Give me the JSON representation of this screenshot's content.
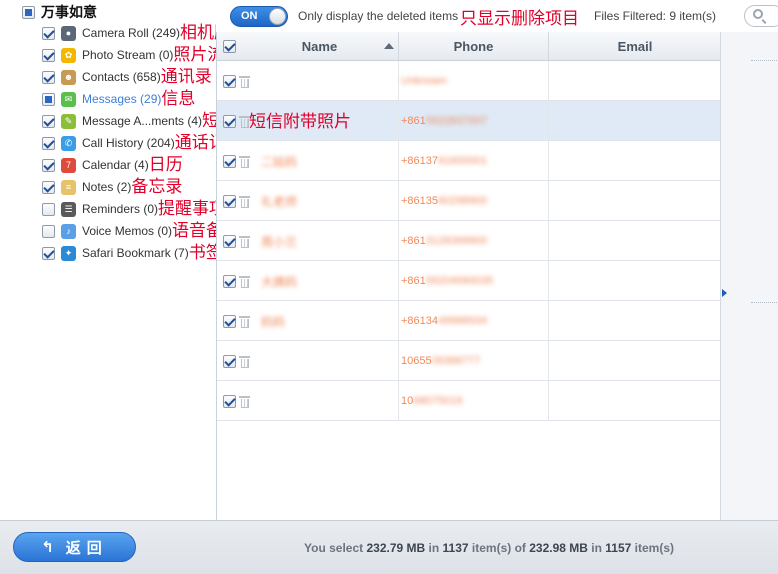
{
  "sidebar": {
    "root": {
      "title": "万事如意",
      "state": "partial"
    },
    "items": [
      {
        "key": "camera-roll",
        "label": "Camera Roll (249)",
        "note": "相机胶卷",
        "state": "checked",
        "icon_color": "#5a6878",
        "glyph": "●"
      },
      {
        "key": "photo-stream",
        "label": "Photo Stream (0)",
        "note": "照片流媒体",
        "state": "checked",
        "icon_color": "#f2b800",
        "glyph": "✿"
      },
      {
        "key": "contacts",
        "label": "Contacts (658)",
        "note": "通讯录",
        "state": "checked",
        "icon_color": "#c89a52",
        "glyph": "☻"
      },
      {
        "key": "messages",
        "label": "Messages (29)",
        "note": "信息",
        "state": "partial",
        "icon_color": "#5bbf4c",
        "glyph": "✉"
      },
      {
        "key": "message-attachments",
        "label": "Message A...ments (4)",
        "note": "短信附带照片",
        "state": "checked",
        "icon_color": "#8bbf3a",
        "glyph": "✎"
      },
      {
        "key": "call-history",
        "label": "Call History (204)",
        "note": "通话记录",
        "state": "checked",
        "icon_color": "#3a9ee6",
        "glyph": "✆"
      },
      {
        "key": "calendar",
        "label": "Calendar (4)",
        "note": "日历",
        "state": "checked",
        "icon_color": "#e04a3a",
        "glyph": "7"
      },
      {
        "key": "notes",
        "label": "Notes (2)",
        "note": "备忘录",
        "state": "checked",
        "icon_color": "#e6c26a",
        "glyph": "≡"
      },
      {
        "key": "reminders",
        "label": "Reminders (0)",
        "note": "提醒事项",
        "state": "unchecked",
        "icon_color": "#5a5a5a",
        "glyph": "☰"
      },
      {
        "key": "voice-memos",
        "label": "Voice Memos (0)",
        "note": "语音备忘录",
        "state": "unchecked",
        "icon_color": "#5aa0e6",
        "glyph": "♪"
      },
      {
        "key": "safari-bookmark",
        "label": "Safari Bookmark (7)",
        "note": "书签",
        "state": "checked",
        "icon_color": "#2a8ad8",
        "glyph": "✦"
      }
    ]
  },
  "topbar": {
    "toggle_label": "ON",
    "toggle_on": true,
    "only_deleted_label": "Only display the deleted items",
    "annotation": "只显示删除项目",
    "filtered_label": "Files Filtered: 9 item(s)",
    "search_placeholder": ""
  },
  "table": {
    "columns": {
      "name": "Name",
      "phone": "Phone",
      "email": "Email"
    },
    "rows": [
      {
        "name": "",
        "phone_prefix": "",
        "phone_blur": "Unknown",
        "email": "",
        "selected": false,
        "note": ""
      },
      {
        "name": "",
        "phone_prefix": "+861",
        "phone_blur": "5922837007",
        "email": "",
        "selected": true,
        "note": "短信附带照片"
      },
      {
        "name": "二姑妈",
        "phone_prefix": "+86137",
        "phone_blur": "91600001",
        "email": "",
        "selected": false,
        "note": ""
      },
      {
        "name": "礼老师",
        "phone_prefix": "+86135",
        "phone_blur": "60298900",
        "email": "",
        "selected": false,
        "note": ""
      },
      {
        "name": "周小兰",
        "phone_prefix": "+861",
        "phone_blur": "3128399900",
        "email": "",
        "selected": false,
        "note": ""
      },
      {
        "name": "大姨妈",
        "phone_prefix": "+861",
        "phone_blur": "59204990035",
        "email": "",
        "selected": false,
        "note": ""
      },
      {
        "name": "妈妈",
        "phone_prefix": "+86134",
        "phone_blur": "49988934",
        "email": "",
        "selected": false,
        "note": ""
      },
      {
        "name": "",
        "phone_prefix": "10655",
        "phone_blur": "09386777",
        "email": "",
        "selected": false,
        "note": ""
      },
      {
        "name": "",
        "phone_prefix": "10",
        "phone_blur": "68075019",
        "email": "",
        "selected": false,
        "note": ""
      }
    ]
  },
  "footer": {
    "back_label": "返回",
    "status_prefix": "You select ",
    "selected_size": "232.79 MB",
    "status_in": " in ",
    "selected_count": "1137",
    "status_of": " item(s) of ",
    "total_size": "232.98 MB",
    "total_count": "1157",
    "status_suffix": " item(s)"
  }
}
